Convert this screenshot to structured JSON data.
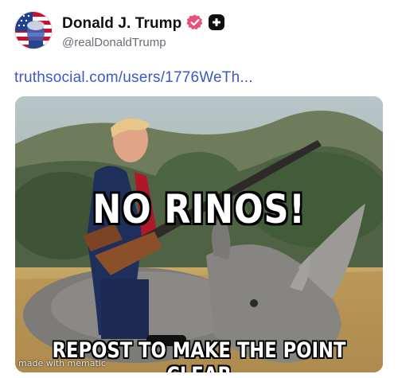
{
  "post": {
    "author_name": "Donald J. Trump",
    "handle": "@realDonaldTrump",
    "link_text": "truthsocial.com/users/1776WeTh...",
    "avatar_icon": "flag-portrait-avatar",
    "verified_icon": "verified-badge-icon",
    "follow_icon": "plus-icon"
  },
  "meme": {
    "top_text": "NO RINOS!",
    "bottom_text": "REPOST TO MAKE THE POINT CLEAR",
    "watermark": "made with mematic"
  },
  "colors": {
    "link": "#3b58c9",
    "verified": "#e5527a",
    "name": "#111111",
    "handle": "#6b6b75"
  }
}
